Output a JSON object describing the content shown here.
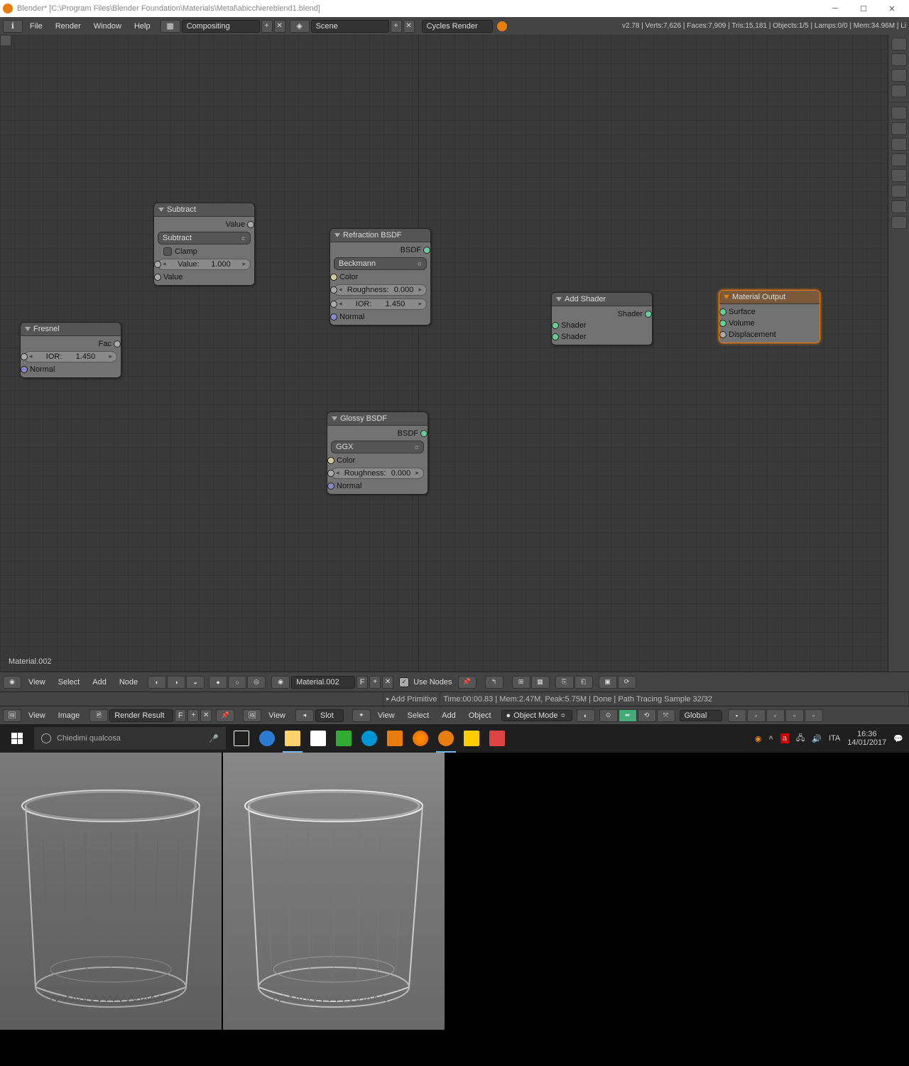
{
  "window": {
    "title": "Blender* [C:\\Program Files\\Blender Foundation\\Materials\\Metal\\abicchiereblend1.blend]"
  },
  "topmenu": {
    "items": [
      "File",
      "Render",
      "Window",
      "Help"
    ],
    "layout": "Compositing",
    "scene": "Scene",
    "engine": "Cycles Render",
    "stats": "v2.78 | Verts:7,626 | Faces:7,909 | Tris:15,181 | Objects:1/5 | Lamps:0/0 | Mem:34.96M | Li"
  },
  "material_label": "Material.002",
  "nodes": {
    "fresnel": {
      "title": "Fresnel",
      "out_fac": "Fac",
      "ior_label": "IOR:",
      "ior_value": "1.450",
      "normal": "Normal"
    },
    "subtract": {
      "title": "Subtract",
      "out_value": "Value",
      "mode": "Subtract",
      "clamp": "Clamp",
      "val_label": "Value:",
      "val_value": "1.000",
      "in_value": "Value"
    },
    "refraction": {
      "title": "Refraction BSDF",
      "out_bsdf": "BSDF",
      "distribution": "Beckmann",
      "color": "Color",
      "rough_label": "Roughness:",
      "rough_value": "0.000",
      "ior_label": "IOR:",
      "ior_value": "1.450",
      "normal": "Normal"
    },
    "glossy": {
      "title": "Glossy BSDF",
      "out_bsdf": "BSDF",
      "distribution": "GGX",
      "color": "Color",
      "rough_label": "Roughness:",
      "rough_value": "0.000",
      "normal": "Normal"
    },
    "addshader": {
      "title": "Add Shader",
      "out": "Shader",
      "in1": "Shader",
      "in2": "Shader"
    },
    "output": {
      "title": "Material Output",
      "surface": "Surface",
      "volume": "Volume",
      "displacement": "Displacement"
    }
  },
  "node_toolbar": {
    "items": [
      "View",
      "Select",
      "Add",
      "Node"
    ],
    "material": "Material.002",
    "f": "F",
    "use_nodes": "Use Nodes"
  },
  "split_info": {
    "add_primitive": "Add Primitive",
    "render_stats": "Time:00:00.83 | Mem:2.47M, Peak:5.75M | Done | Path Tracing Sample 32/32"
  },
  "img_toolbar": {
    "items1": [
      "View",
      "Image"
    ],
    "render_result": "Render Result",
    "f": "F",
    "items2": [
      "View"
    ],
    "slot": "Slot",
    "items3": [
      "View",
      "Select",
      "Add",
      "Object"
    ],
    "mode": "Object Mode",
    "global": "Global"
  },
  "taskbar": {
    "search_placeholder": "Chiedimi qualcosa",
    "lang": "ITA",
    "time": "16:36",
    "date": "14/01/2017"
  }
}
